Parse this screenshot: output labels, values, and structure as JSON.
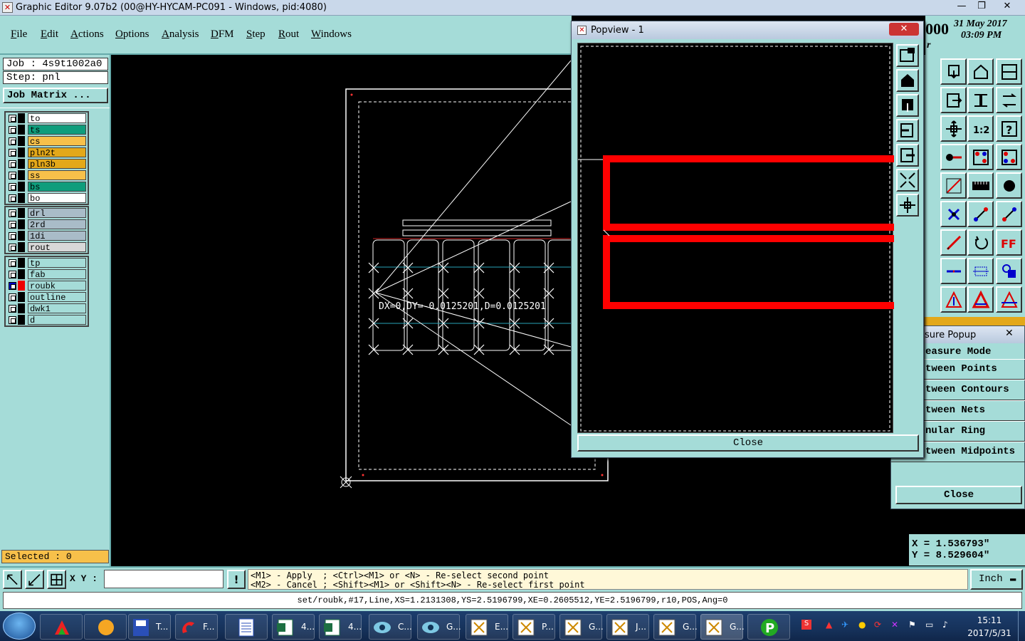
{
  "window": {
    "title": "Graphic Editor 9.07b2 (00@HY-HYCAM-PC091 - Windows, pid:4080)",
    "min": "—",
    "max": "❐",
    "close": "✕"
  },
  "menu": [
    "File",
    "Edit",
    "Actions",
    "Options",
    "Analysis",
    "DFM",
    "Step",
    "Rout",
    "Windows"
  ],
  "header_right": {
    "brand_fragment": "000",
    "date": "31 May 2017",
    "time": "03:09 PM",
    "tag": "r"
  },
  "job": {
    "job_label": "Job : 4s9t1002a0",
    "step_label": "Step: pnl",
    "matrix_button": "Job Matrix ..."
  },
  "layers_group1": [
    {
      "name": "to",
      "color": "#ffffff"
    },
    {
      "name": "ts",
      "color": "#0e9d7c"
    },
    {
      "name": "cs",
      "color": "#f7c04a"
    },
    {
      "name": "pln2t",
      "color": "#e3a81a"
    },
    {
      "name": "pln3b",
      "color": "#e3a81a"
    },
    {
      "name": "ss",
      "color": "#f7c04a"
    },
    {
      "name": "bs",
      "color": "#0e9d7c"
    },
    {
      "name": "bo",
      "color": "#ffffff"
    }
  ],
  "layers_group2": [
    {
      "name": "drl",
      "color": "#a9bcc8"
    },
    {
      "name": "2rd",
      "color": "#a9bcc8"
    },
    {
      "name": "1di",
      "color": "#a9bcc8"
    },
    {
      "name": "rout",
      "color": "#d8d8d8"
    }
  ],
  "layers_group3": [
    {
      "name": "tp",
      "color": "#a5dcd8"
    },
    {
      "name": "fab",
      "color": "#a5dcd8"
    },
    {
      "name": "roubk",
      "color": "#a5dcd8",
      "active": true
    },
    {
      "name": "outline",
      "color": "#a5dcd8"
    },
    {
      "name": "dwk1",
      "color": "#a5dcd8"
    },
    {
      "name": "d",
      "color": "#a5dcd8"
    }
  ],
  "selected": "Selected : 0",
  "canvas": {
    "measure_text": "DX=0,DY=-0.0125201,D=0.0125201"
  },
  "popview": {
    "title": "Popview - 1",
    "close_label": "Close",
    "close_x": "✕"
  },
  "measure": {
    "title": "sure Popup",
    "mode_label": "easure Mode",
    "options": [
      "tween Points",
      "tween Contours",
      "tween Nets",
      "nular Ring",
      "tween Midpoints"
    ],
    "close_label": "Close",
    "close_x": "✕"
  },
  "coords": {
    "x": "X = 1.536793\"",
    "y": "Y = 8.529604\""
  },
  "status": {
    "xy_label": "X Y :",
    "xy_value": "",
    "hint1": "<M1> - Apply  ; <Ctrl><M1> or <N> - Re-select second point",
    "hint2": "<M2> - Cancel ; <Shift><M1> or <Shift><N> - Re-select first point",
    "units": "Inch",
    "bang": "!"
  },
  "command": "set/roubk,#17,Line,XS=1.2131308,YS=2.5196799,XE=0.2605512,YE=2.5196799,r10,POS,Ang=0",
  "taskbar": {
    "items": [
      "T...",
      "F...",
      "",
      "4...",
      "4...",
      "C...",
      "G...",
      "E...",
      "P...",
      "G...",
      "J...",
      "G...",
      "G..."
    ],
    "clock_time": "15:11",
    "clock_date": "2017/5/31"
  }
}
